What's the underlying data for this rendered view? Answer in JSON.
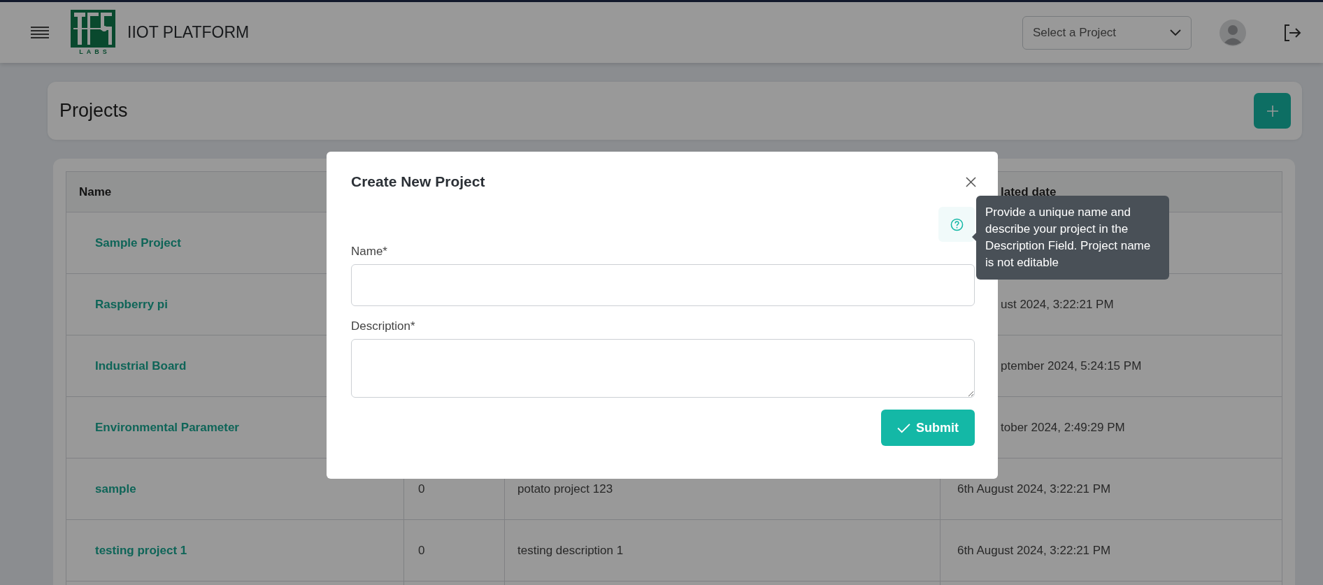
{
  "header": {
    "logo_text": "LABS",
    "title": "IIOT PLATFORM",
    "project_select": {
      "placeholder": "Select a Project"
    }
  },
  "page": {
    "title": "Projects"
  },
  "table": {
    "columns": {
      "name": "Name",
      "column_4": "lated date"
    },
    "rows": [
      {
        "name": "Sample Project"
      },
      {
        "name": "Raspberry pi",
        "date": "ust 2024, 3:22:21 PM"
      },
      {
        "name": "Industrial Board",
        "date": "ptember 2024, 5:24:15 PM"
      },
      {
        "name": "Environmental Parameter",
        "date": "tober 2024, 2:49:29 PM"
      },
      {
        "name": "sample",
        "count": "0",
        "description": "potato project 123",
        "date": "6th August 2024, 3:22:21 PM"
      },
      {
        "name": "testing project 1",
        "count": "0",
        "description": "testing description 1",
        "date": "6th August 2024, 3:22:21 PM"
      }
    ]
  },
  "modal": {
    "title": "Create New Project",
    "fields": [
      {
        "label": "Name*",
        "kind": "input"
      },
      {
        "label": "Description*",
        "kind": "textarea"
      }
    ],
    "submit": "Submit",
    "tooltip": "Provide a unique name and describe your project in the Description Field. Project name is not editable"
  }
}
